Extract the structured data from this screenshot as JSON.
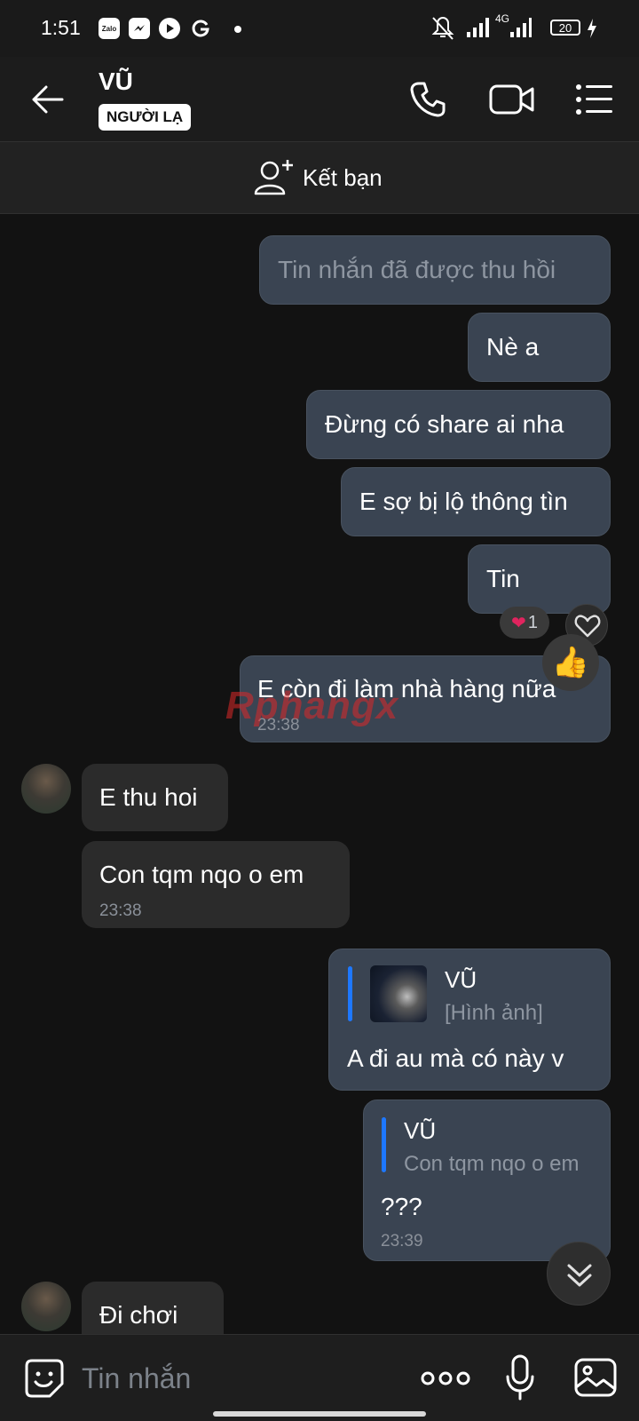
{
  "status_bar": {
    "time": "1:51",
    "app_icons": [
      "zalo-icon",
      "messenger-icon",
      "youtube-icon",
      "google-icon"
    ],
    "zalo_label": "Zalo",
    "network": "4G",
    "battery": "20"
  },
  "header": {
    "contact_name": "VŨ",
    "badge": "NGƯỜI LẠ"
  },
  "add_friend": {
    "label": "Kết bạn"
  },
  "messages": {
    "recalled": "Tin nhắn đã được thu hồi",
    "m1": "Nè a",
    "m2": "Đừng có share ai nha",
    "m3": "E sợ bị lộ thông tìn",
    "m4": "Tin",
    "m4_reaction_count": "1",
    "m5": "E còn đi làm nhà hàng nữa",
    "m5_time": "23:38",
    "r1": "E thu hoi",
    "r2": "Con tqm nqo o em",
    "r2_time": "23:38",
    "q1": {
      "quote_name": "VŨ",
      "quote_sub": "[Hình ảnh]",
      "text": "A đi au mà có này v"
    },
    "q2": {
      "quote_name": "VŨ",
      "quote_sub": "Con tqm nqo o em",
      "text": "???",
      "time": "23:39"
    },
    "r3": "Đi chơi"
  },
  "watermark": "Rphangx",
  "input": {
    "placeholder": "Tin nhắn"
  },
  "colors": {
    "background": "#121212",
    "sent_bubble": "#3a4452",
    "received_bubble": "#2b2b2b",
    "quote_accent": "#1e78ff"
  }
}
